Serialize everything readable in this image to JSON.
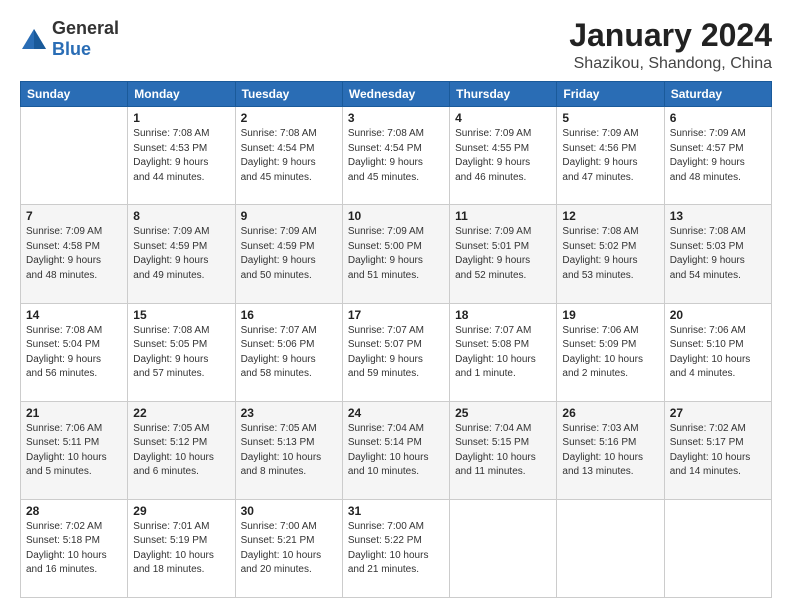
{
  "logo": {
    "general": "General",
    "blue": "Blue"
  },
  "title": "January 2024",
  "subtitle": "Shazikou, Shandong, China",
  "header": {
    "days": [
      "Sunday",
      "Monday",
      "Tuesday",
      "Wednesday",
      "Thursday",
      "Friday",
      "Saturday"
    ]
  },
  "weeks": [
    [
      {
        "day": "",
        "info": ""
      },
      {
        "day": "1",
        "info": "Sunrise: 7:08 AM\nSunset: 4:53 PM\nDaylight: 9 hours\nand 44 minutes."
      },
      {
        "day": "2",
        "info": "Sunrise: 7:08 AM\nSunset: 4:54 PM\nDaylight: 9 hours\nand 45 minutes."
      },
      {
        "day": "3",
        "info": "Sunrise: 7:08 AM\nSunset: 4:54 PM\nDaylight: 9 hours\nand 45 minutes."
      },
      {
        "day": "4",
        "info": "Sunrise: 7:09 AM\nSunset: 4:55 PM\nDaylight: 9 hours\nand 46 minutes."
      },
      {
        "day": "5",
        "info": "Sunrise: 7:09 AM\nSunset: 4:56 PM\nDaylight: 9 hours\nand 47 minutes."
      },
      {
        "day": "6",
        "info": "Sunrise: 7:09 AM\nSunset: 4:57 PM\nDaylight: 9 hours\nand 48 minutes."
      }
    ],
    [
      {
        "day": "7",
        "info": "Sunrise: 7:09 AM\nSunset: 4:58 PM\nDaylight: 9 hours\nand 48 minutes."
      },
      {
        "day": "8",
        "info": "Sunrise: 7:09 AM\nSunset: 4:59 PM\nDaylight: 9 hours\nand 49 minutes."
      },
      {
        "day": "9",
        "info": "Sunrise: 7:09 AM\nSunset: 4:59 PM\nDaylight: 9 hours\nand 50 minutes."
      },
      {
        "day": "10",
        "info": "Sunrise: 7:09 AM\nSunset: 5:00 PM\nDaylight: 9 hours\nand 51 minutes."
      },
      {
        "day": "11",
        "info": "Sunrise: 7:09 AM\nSunset: 5:01 PM\nDaylight: 9 hours\nand 52 minutes."
      },
      {
        "day": "12",
        "info": "Sunrise: 7:08 AM\nSunset: 5:02 PM\nDaylight: 9 hours\nand 53 minutes."
      },
      {
        "day": "13",
        "info": "Sunrise: 7:08 AM\nSunset: 5:03 PM\nDaylight: 9 hours\nand 54 minutes."
      }
    ],
    [
      {
        "day": "14",
        "info": "Sunrise: 7:08 AM\nSunset: 5:04 PM\nDaylight: 9 hours\nand 56 minutes."
      },
      {
        "day": "15",
        "info": "Sunrise: 7:08 AM\nSunset: 5:05 PM\nDaylight: 9 hours\nand 57 minutes."
      },
      {
        "day": "16",
        "info": "Sunrise: 7:07 AM\nSunset: 5:06 PM\nDaylight: 9 hours\nand 58 minutes."
      },
      {
        "day": "17",
        "info": "Sunrise: 7:07 AM\nSunset: 5:07 PM\nDaylight: 9 hours\nand 59 minutes."
      },
      {
        "day": "18",
        "info": "Sunrise: 7:07 AM\nSunset: 5:08 PM\nDaylight: 10 hours\nand 1 minute."
      },
      {
        "day": "19",
        "info": "Sunrise: 7:06 AM\nSunset: 5:09 PM\nDaylight: 10 hours\nand 2 minutes."
      },
      {
        "day": "20",
        "info": "Sunrise: 7:06 AM\nSunset: 5:10 PM\nDaylight: 10 hours\nand 4 minutes."
      }
    ],
    [
      {
        "day": "21",
        "info": "Sunrise: 7:06 AM\nSunset: 5:11 PM\nDaylight: 10 hours\nand 5 minutes."
      },
      {
        "day": "22",
        "info": "Sunrise: 7:05 AM\nSunset: 5:12 PM\nDaylight: 10 hours\nand 6 minutes."
      },
      {
        "day": "23",
        "info": "Sunrise: 7:05 AM\nSunset: 5:13 PM\nDaylight: 10 hours\nand 8 minutes."
      },
      {
        "day": "24",
        "info": "Sunrise: 7:04 AM\nSunset: 5:14 PM\nDaylight: 10 hours\nand 10 minutes."
      },
      {
        "day": "25",
        "info": "Sunrise: 7:04 AM\nSunset: 5:15 PM\nDaylight: 10 hours\nand 11 minutes."
      },
      {
        "day": "26",
        "info": "Sunrise: 7:03 AM\nSunset: 5:16 PM\nDaylight: 10 hours\nand 13 minutes."
      },
      {
        "day": "27",
        "info": "Sunrise: 7:02 AM\nSunset: 5:17 PM\nDaylight: 10 hours\nand 14 minutes."
      }
    ],
    [
      {
        "day": "28",
        "info": "Sunrise: 7:02 AM\nSunset: 5:18 PM\nDaylight: 10 hours\nand 16 minutes."
      },
      {
        "day": "29",
        "info": "Sunrise: 7:01 AM\nSunset: 5:19 PM\nDaylight: 10 hours\nand 18 minutes."
      },
      {
        "day": "30",
        "info": "Sunrise: 7:00 AM\nSunset: 5:21 PM\nDaylight: 10 hours\nand 20 minutes."
      },
      {
        "day": "31",
        "info": "Sunrise: 7:00 AM\nSunset: 5:22 PM\nDaylight: 10 hours\nand 21 minutes."
      },
      {
        "day": "",
        "info": ""
      },
      {
        "day": "",
        "info": ""
      },
      {
        "day": "",
        "info": ""
      }
    ]
  ]
}
